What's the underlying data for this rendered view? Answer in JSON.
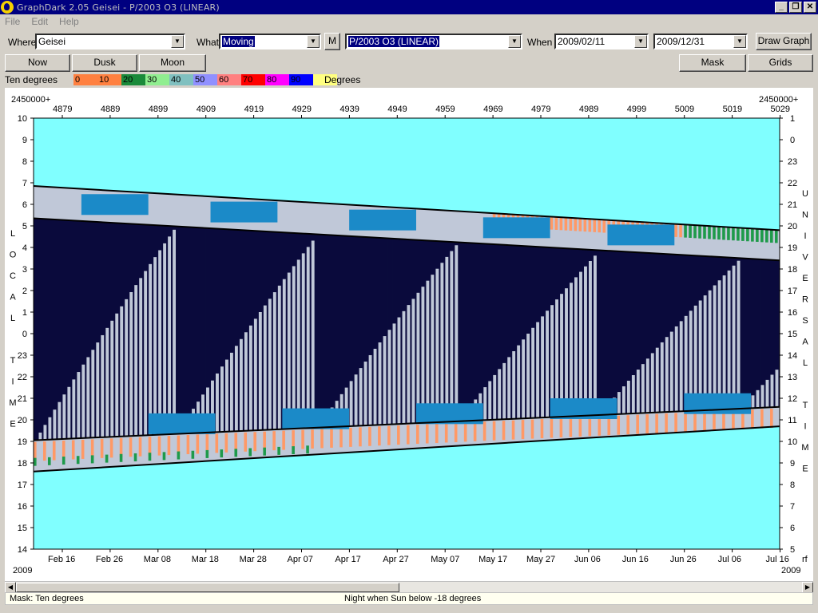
{
  "window": {
    "title": "GraphDark 2.05  Geisei  -  P/2003 O3 (LINEAR)",
    "controls": {
      "minimize": "_",
      "restore": "❐",
      "close": "✕"
    }
  },
  "menu": {
    "items": [
      "File",
      "Edit",
      "Help"
    ]
  },
  "toolbar": {
    "where_label": "Where",
    "where_value": "Geisei",
    "what_label": "What",
    "what_value": "Moving",
    "m_button": "M",
    "object_value": "P/2003 O3 (LINEAR)",
    "when_label": "When",
    "start_date": "2009/02/11",
    "end_date": "2009/12/31",
    "draw_button": "Draw Graph"
  },
  "buttons": {
    "now": "Now",
    "dusk": "Dusk",
    "moon": "Moon",
    "mask": "Mask",
    "grids": "Grids"
  },
  "legend": {
    "label": "Ten degrees",
    "unit": "Degrees",
    "steps": [
      {
        "text": "0",
        "color": "#ff8040"
      },
      {
        "text": "10",
        "color": "#ff8040"
      },
      {
        "text": "20",
        "color": "#1a8a3a"
      },
      {
        "text": "30",
        "color": "#90ee90"
      },
      {
        "text": "40",
        "color": "#80c0c0"
      },
      {
        "text": "50",
        "color": "#9090ff"
      },
      {
        "text": "60",
        "color": "#ff8080"
      },
      {
        "text": "70",
        "color": "#ff0000"
      },
      {
        "text": "80",
        "color": "#ff00ff"
      },
      {
        "text": "90",
        "color": "#0000ff"
      },
      {
        "text": "",
        "color": "#ffff80"
      }
    ]
  },
  "graph": {
    "jd_prefix": "2450000+",
    "jd_ticks": [
      "4879",
      "4889",
      "4899",
      "4909",
      "4919",
      "4929",
      "4939",
      "4949",
      "4959",
      "4969",
      "4979",
      "4989",
      "4999",
      "5009",
      "5019",
      "5029"
    ],
    "date_ticks": [
      "Feb 16",
      "Feb 26",
      "Mar 08",
      "Mar 18",
      "Mar 28",
      "Apr 07",
      "Apr 17",
      "Apr 27",
      "May 07",
      "May 17",
      "May 27",
      "Jun 06",
      "Jun 16",
      "Jun 26",
      "Jul 06",
      "Jul 16"
    ],
    "year_left": "2009",
    "year_right": "2009",
    "corner_right": "rf",
    "local_hours": [
      "10",
      "9",
      "8",
      "7",
      "6",
      "5",
      "4",
      "3",
      "2",
      "1",
      "0",
      "23",
      "22",
      "21",
      "20",
      "19",
      "18",
      "17",
      "16",
      "15",
      "14"
    ],
    "ut_hours": [
      "1",
      "0",
      "23",
      "22",
      "21",
      "20",
      "19",
      "18",
      "17",
      "16",
      "15",
      "14",
      "13",
      "12",
      "11",
      "10",
      "9",
      "8",
      "7",
      "6",
      "5"
    ],
    "left_axis_letters": [
      "L",
      "O",
      "C",
      "A",
      "L",
      "",
      "T",
      "I",
      "M",
      "E"
    ],
    "right_axis_letters": [
      "U",
      "N",
      "I",
      "V",
      "E",
      "R",
      "S",
      "A",
      "L",
      "",
      "T",
      "I",
      "M",
      "E"
    ],
    "colors": {
      "sky": "#80ffff",
      "night": "#0a0a3c",
      "moon_bar": "#c0c8d8",
      "twilight_blue": "#1b8ac8",
      "orange": "#ff9966",
      "green": "#1e9a4a"
    }
  },
  "status": {
    "mask": "Mask:  Ten degrees",
    "night": "Night when Sun below -18 degrees"
  }
}
